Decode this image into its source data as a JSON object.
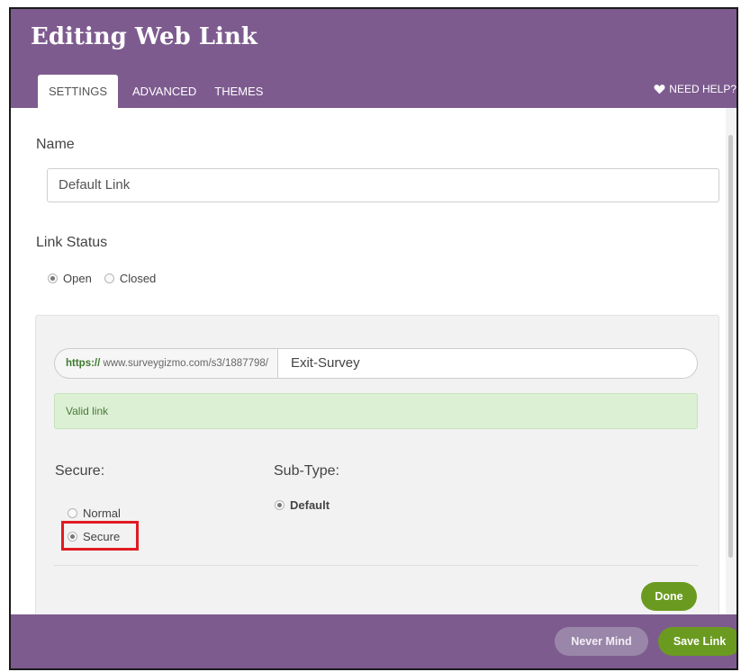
{
  "dialog": {
    "title": "Editing Web Link"
  },
  "tabs": [
    {
      "label": "SETTINGS",
      "active": true
    },
    {
      "label": "ADVANCED",
      "active": false
    },
    {
      "label": "THEMES",
      "active": false
    }
  ],
  "help": {
    "label": "NEED HELP?",
    "icon": "heart-icon"
  },
  "name": {
    "label": "Name",
    "value": "Default Link"
  },
  "link_status": {
    "label": "Link Status",
    "options": [
      {
        "label": "Open",
        "checked": true
      },
      {
        "label": "Closed",
        "checked": false
      }
    ]
  },
  "url": {
    "scheme": "https://",
    "base": " www.surveygizmo.com/s3/1887798/",
    "slug": "Exit-Survey"
  },
  "validation": {
    "message": "Valid link"
  },
  "secure": {
    "label": "Secure:",
    "options": [
      {
        "label": "Normal",
        "checked": false
      },
      {
        "label": "Secure",
        "checked": true
      }
    ]
  },
  "subtype": {
    "label": "Sub-Type:",
    "options": [
      {
        "label": "Default",
        "checked": true
      }
    ]
  },
  "buttons": {
    "done": "Done",
    "never_mind": "Never Mind",
    "save_link": "Save Link"
  },
  "colors": {
    "brand_purple": "#7d5b8f",
    "action_green": "#6a9b20",
    "highlight_red": "#e11b22",
    "valid_bg": "#dcf0d4"
  }
}
